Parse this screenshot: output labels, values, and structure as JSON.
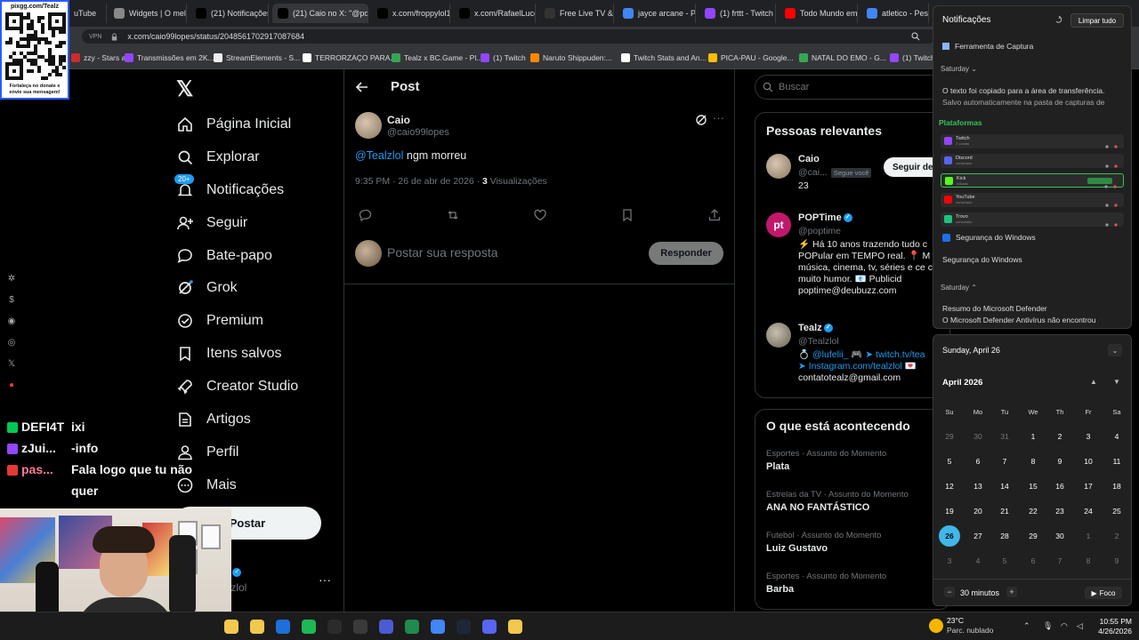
{
  "browser": {
    "tabs": [
      {
        "label": "uTube",
        "color": "#ff0000"
      },
      {
        "label": "Widgets | O melh",
        "color": "#888888"
      },
      {
        "label": "(21) Notificações",
        "color": "#000000"
      },
      {
        "label": "(21) Caio no X: \"@popti",
        "color": "#000000"
      },
      {
        "label": "x.com/froppylol1",
        "color": "#000000"
      },
      {
        "label": "x.com/RafaelLuce",
        "color": "#000000"
      },
      {
        "label": "Free Live TV & O",
        "color": "#333333"
      },
      {
        "label": "jayce arcane - Pe",
        "color": "#4285f4"
      },
      {
        "label": "(1) frttt - Twitch",
        "color": "#9146ff"
      },
      {
        "label": "Todo Mundo em",
        "color": "#ff0000"
      },
      {
        "label": "atletico - Pesqui",
        "color": "#4285f4"
      }
    ],
    "vpn_label": "VPN",
    "url": "x.com/caio99lopes/status/2048561702917087684",
    "bookmarks": [
      {
        "label": "zzy - Stars a...",
        "color": "#cc2b2b"
      },
      {
        "label": "Transmissões em 2K...",
        "color": "#9146ff"
      },
      {
        "label": "StreamElements - S...",
        "color": "#eeeeee"
      },
      {
        "label": "TERRORZAÇO PARA...",
        "color": "#ffffff"
      },
      {
        "label": "Tealz x BC.Game - Pl...",
        "color": "#34a853"
      },
      {
        "label": "(1) Twitch",
        "color": "#9146ff"
      },
      {
        "label": "Naruto Shippuden:...",
        "color": "#ff8800"
      },
      {
        "label": "Twitch Stats and An...",
        "color": "#ffffff"
      },
      {
        "label": "PICA-PAU - Google...",
        "color": "#fbbc05"
      },
      {
        "label": "NATAL DO EMO - G...",
        "color": "#34a853"
      },
      {
        "label": "(1) Twitch",
        "color": "#9146ff"
      }
    ]
  },
  "overlay": {
    "qr_title": "pixgg.com/Tealz",
    "qr_footer_1": "Fortaleça no donate e",
    "qr_footer_2": "envie sua mensagem!",
    "chat": [
      {
        "user": "DEFI4T",
        "msg": "ixi",
        "color": "#00c853"
      },
      {
        "user": "zJui...",
        "msg": "-info",
        "color": "#9146ff"
      },
      {
        "user": "pas...",
        "msg": "Fala logo que tu não",
        "color": "#e53935"
      },
      {
        "user": "",
        "msg": "quer",
        "color": ""
      }
    ]
  },
  "nav": {
    "logo": "𝕏",
    "items": [
      {
        "label": "Página Inicial",
        "icon": "home-icon"
      },
      {
        "label": "Explorar",
        "icon": "search-icon"
      },
      {
        "label": "Notificações",
        "icon": "bell-icon",
        "badge": "20+"
      },
      {
        "label": "Seguir",
        "icon": "follow-icon"
      },
      {
        "label": "Bate-papo",
        "icon": "chat-icon"
      },
      {
        "label": "Grok",
        "icon": "grok-icon"
      },
      {
        "label": "Premium",
        "icon": "premium-icon"
      },
      {
        "label": "Itens salvos",
        "icon": "bookmark-icon"
      },
      {
        "label": "Creator Studio",
        "icon": "rocket-icon"
      },
      {
        "label": "Artigos",
        "icon": "article-icon"
      },
      {
        "label": "Perfil",
        "icon": "profile-icon"
      },
      {
        "label": "Mais",
        "icon": "more-icon"
      }
    ],
    "post_button": "Postar",
    "account_name": "z",
    "account_handle": "alzlol",
    "account_more": "···"
  },
  "main": {
    "title": "Post",
    "author_name": "Caio",
    "author_handle": "@caio99lopes",
    "mention": "@Tealzlol",
    "text": " ngm morreu",
    "meta": "9:35 PM · 26 de abr de 2026 · ",
    "views_count": "3",
    "views_label": " Visualizações",
    "reply_placeholder": "Postar sua resposta",
    "reply_button": "Responder"
  },
  "right": {
    "search_placeholder": "Buscar",
    "relevant_title": "Pessoas relevantes",
    "people": [
      {
        "name": "Caio",
        "handle": "@cai...",
        "follows_you": "Segue você",
        "bio": "23",
        "button": "Seguir de"
      },
      {
        "name": "POPTime",
        "handle": "@poptime",
        "bio": "⚡ Há 10 anos trazendo tudo c POPular em TEMPO real. 📍 M música, cinema, tv, séries e ce com muito humor. 📧 Publicid poptime@deubuzz.com",
        "logo": "pt"
      },
      {
        "name": "Tealz",
        "handle": "@Tealzlol",
        "bio_1": "💍 @lufelii_ 🎮 ➤ twitch.tv/tea",
        "bio_2": "➤ Instagram.com/tealzlol 💌",
        "bio_3": "contatotealz@gmail.com"
      }
    ],
    "trends_title": "O que está acontecendo",
    "trends": [
      {
        "category": "Esportes · Assunto do Momento",
        "title": "Plata"
      },
      {
        "category": "Estrelas da TV · Assunto do Momento",
        "title": "ANA NO FANTÁSTICO"
      },
      {
        "category": "Futebol · Assunto do Momento",
        "title": "Luiz Gustavo"
      },
      {
        "category": "Esportes · Assunto do Momento",
        "title": "Barba"
      }
    ]
  },
  "notifications": {
    "title": "Notificações",
    "clear_all": "Limpar tudo",
    "capture_app": "Ferramenta de Captura",
    "group_saturday_1": "Saturday",
    "copy_line_1": "O texto foi copiado para a área de transferência.",
    "copy_line_2": "Salvo automaticamente na pasta de capturas de",
    "platforms_title": "Plataformas",
    "platforms": [
      {
        "name": "Twitch",
        "color": "#9146ff",
        "sub": "2 contas"
      },
      {
        "name": "Discord",
        "color": "#5865f2",
        "sub": "conectado"
      },
      {
        "name": "Kick",
        "color": "#53fc18",
        "sub": "Ativado",
        "live": true
      },
      {
        "name": "YouTube",
        "color": "#ff0000",
        "sub": "conectado"
      },
      {
        "name": "Trovo",
        "color": "#1bc47d",
        "sub": "conectado"
      }
    ],
    "security_app": "Segurança do Windows",
    "security_line": "Segurança do Windows",
    "group_saturday_2": "Saturday",
    "defender_title": "Resumo do Microsoft Defender",
    "defender_line": "O Microsoft Defender Antivírus não encontrou"
  },
  "calendar": {
    "date_header": "Sunday, April 26",
    "month": "April 2026",
    "weekdays": [
      "Su",
      "Mo",
      "Tu",
      "We",
      "Th",
      "Fr",
      "Sa"
    ],
    "days": [
      [
        "29",
        "30",
        "31",
        "1",
        "2",
        "3",
        "4"
      ],
      [
        "5",
        "6",
        "7",
        "8",
        "9",
        "10",
        "11"
      ],
      [
        "12",
        "13",
        "14",
        "15",
        "16",
        "17",
        "18"
      ],
      [
        "19",
        "20",
        "21",
        "22",
        "23",
        "24",
        "25"
      ],
      [
        "26",
        "27",
        "28",
        "29",
        "30",
        "1",
        "2"
      ],
      [
        "3",
        "4",
        "5",
        "6",
        "7",
        "8",
        "9"
      ]
    ],
    "today": "26",
    "focus_minutes": "30 minutos",
    "focus_button": "Foco"
  },
  "taskbar": {
    "temp": "23°C",
    "weather": "Parc. nublado",
    "time": "10:55 PM",
    "date": "4/26/2026",
    "apps": [
      "#f2c94c",
      "#f2c94c",
      "#1e6fd9",
      "#1db954",
      "#2b2b2b",
      "#3a3a3a",
      "#4a5bd4",
      "#1f8b4c",
      "#4285f4",
      "#1b2838",
      "#5865f2",
      "#f2c94c"
    ]
  }
}
